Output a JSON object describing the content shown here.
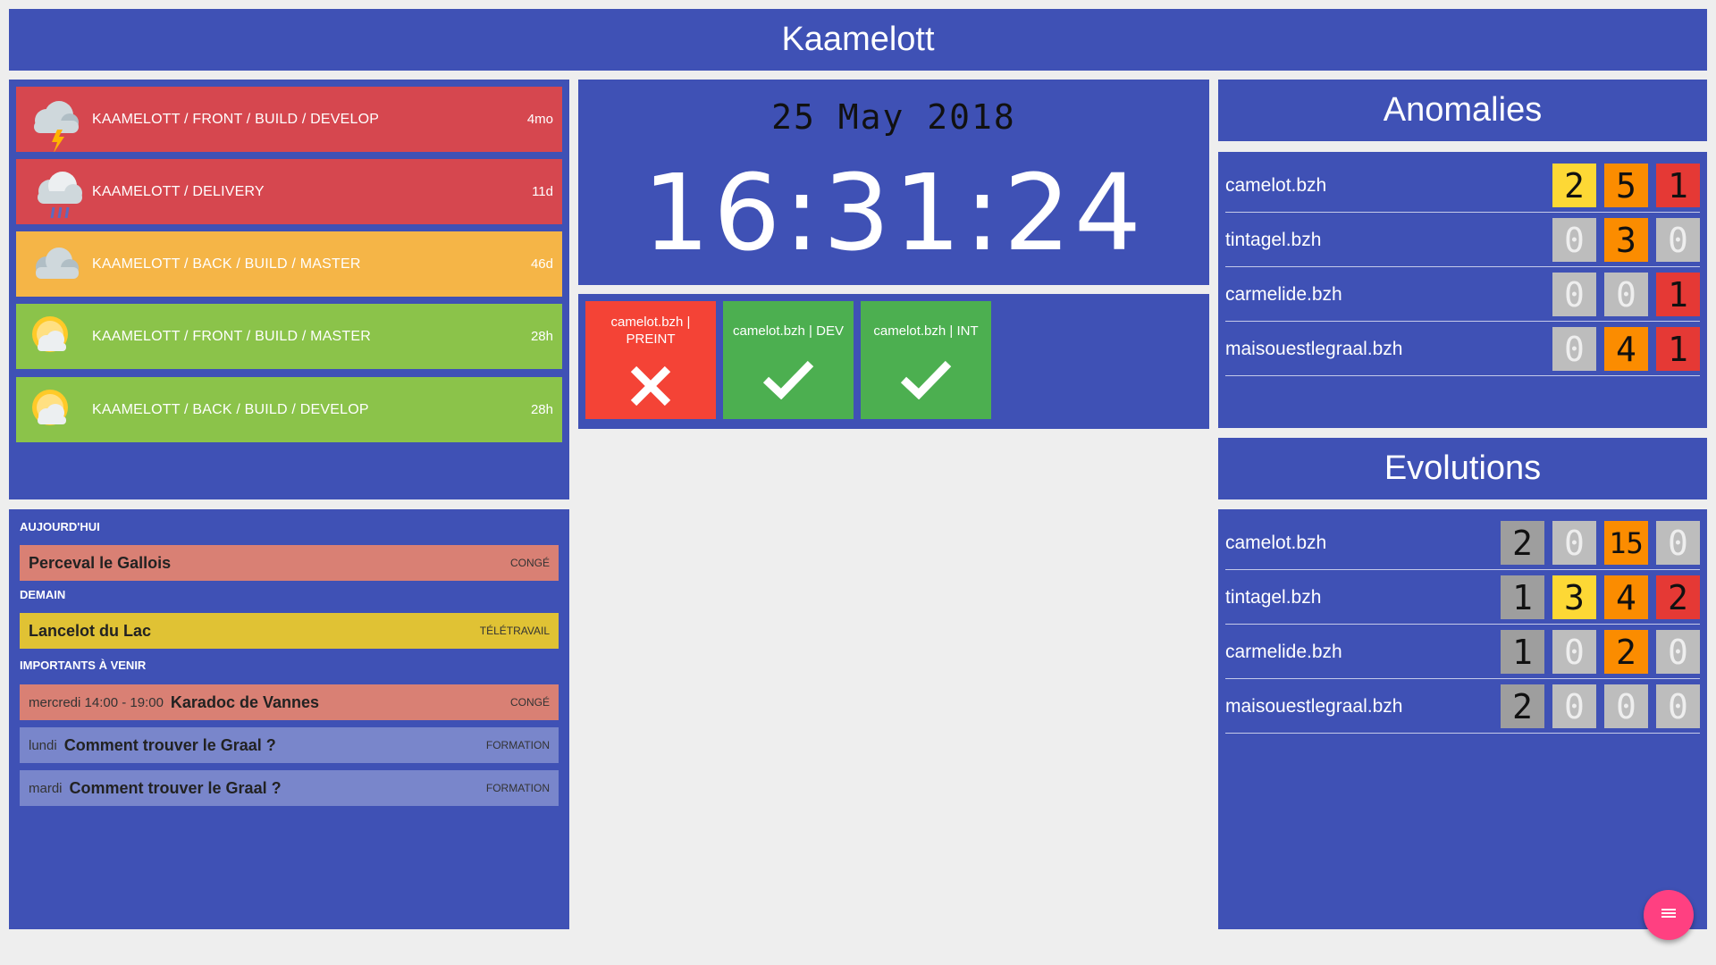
{
  "header": {
    "title": "Kaamelott"
  },
  "builds": [
    {
      "name": "KAAMELOTT / FRONT / BUILD / DEVELOP",
      "age": "4mo",
      "weather": "thunderstorm-icon",
      "color": "#d6474f"
    },
    {
      "name": "KAAMELOTT / DELIVERY",
      "age": "11d",
      "weather": "rain-icon",
      "color": "#d6474f"
    },
    {
      "name": "KAAMELOTT / BACK / BUILD / MASTER",
      "age": "46d",
      "weather": "cloudy-icon",
      "color": "#f5b547"
    },
    {
      "name": "KAAMELOTT / FRONT / BUILD / MASTER",
      "age": "28h",
      "weather": "sun-cloud-icon",
      "color": "#8bc34a"
    },
    {
      "name": "KAAMELOTT / BACK / BUILD / DEVELOP",
      "age": "28h",
      "weather": "sun-cloud-icon",
      "color": "#8bc34a"
    }
  ],
  "clock": {
    "date": "25 May 2018",
    "time": "16:31:24"
  },
  "environments": [
    {
      "label": "camelot.bzh | PREINT",
      "status": "failed",
      "color": "#f44336"
    },
    {
      "label": "camelot.bzh | DEV",
      "status": "ok",
      "color": "#4caf50"
    },
    {
      "label": "camelot.bzh | INT",
      "status": "ok",
      "color": "#4caf50"
    }
  ],
  "agenda": {
    "today_label": "AUJOURD'HUI",
    "tomorrow_label": "DEMAIN",
    "upcoming_label": "IMPORTANTS À VENIR",
    "today": [
      {
        "when": "",
        "who": "Perceval le Gallois",
        "tag": "CONGÉ",
        "color": "#d98074"
      }
    ],
    "tomorrow": [
      {
        "when": "",
        "who": "Lancelot du Lac",
        "tag": "TÉLÉTRAVAIL",
        "color": "#e0c234"
      }
    ],
    "upcoming": [
      {
        "when": "mercredi 14:00 - 19:00",
        "who": "Karadoc de Vannes",
        "tag": "CONGÉ",
        "color": "#d98074"
      },
      {
        "when": "lundi",
        "who": "Comment trouver le Graal ?",
        "tag": "FORMATION",
        "color": "#7986cb"
      },
      {
        "when": "mardi",
        "who": "Comment trouver le Graal ?",
        "tag": "FORMATION",
        "color": "#7986cb"
      }
    ]
  },
  "anomalies": {
    "title": "Anomalies",
    "rows": [
      {
        "host": "camelot.bzh",
        "counts": [
          2,
          5,
          1
        ]
      },
      {
        "host": "tintagel.bzh",
        "counts": [
          0,
          3,
          0
        ]
      },
      {
        "host": "carmelide.bzh",
        "counts": [
          0,
          0,
          1
        ]
      },
      {
        "host": "maisouestlegraal.bzh",
        "counts": [
          0,
          4,
          1
        ]
      }
    ],
    "colors": [
      "#fdd835",
      "#fb8c00",
      "#e53935"
    ]
  },
  "evolutions": {
    "title": "Evolutions",
    "rows": [
      {
        "host": "camelot.bzh",
        "counts": [
          2,
          0,
          15,
          0
        ]
      },
      {
        "host": "tintagel.bzh",
        "counts": [
          1,
          3,
          4,
          2
        ]
      },
      {
        "host": "carmelide.bzh",
        "counts": [
          1,
          0,
          2,
          0
        ]
      },
      {
        "host": "maisouestlegraal.bzh",
        "counts": [
          2,
          0,
          0,
          0
        ]
      }
    ],
    "colors": [
      "#9e9e9e",
      "#fdd835",
      "#fb8c00",
      "#e53935"
    ],
    "zero_color": "#bdbdbd"
  },
  "fab": {
    "icon": "menu-icon",
    "color": "#ff4081"
  }
}
